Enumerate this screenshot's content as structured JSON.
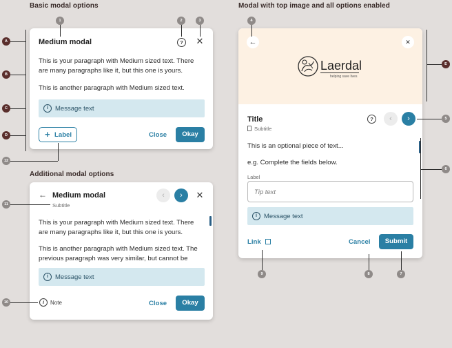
{
  "sections": {
    "basic": "Basic modal options",
    "additional": "Additional modal options",
    "top_image": "Modal with top image and all options enabled"
  },
  "basic_modal": {
    "title": "Medium modal",
    "para1": "This is your paragraph with Medium sized text. There are many paragraphs like it, but this one is yours.",
    "para2": "This is another paragraph with Medium sized text.",
    "message": "Message text",
    "label_button": "Label",
    "label_button_icon": "plus-icon",
    "close_button": "Close",
    "okay_button": "Okay"
  },
  "additional_modal": {
    "title": "Medium modal",
    "subtitle": "Subtitle",
    "para1": "This is your paragraph with Medium sized text. There are many paragraphs like it, but this one is yours.",
    "para2": "This is another paragraph with Medium sized text. The previous paragraph was very similar, but cannot be",
    "message": "Message text",
    "note": "Note",
    "close_button": "Close",
    "okay_button": "Okay"
  },
  "image_modal": {
    "logo_text": "Laerdal",
    "logo_tagline": "helping save lives",
    "title": "Title",
    "subtitle": "Subtitle",
    "text1": "This is an optional piece of text...",
    "text2": "e.g. Complete the fields below.",
    "field_label": "Label",
    "field_placeholder": "Tip text",
    "message": "Message text",
    "link": "Link",
    "cancel_button": "Cancel",
    "submit_button": "Submit"
  },
  "markers": {
    "m1": "1",
    "m2": "2",
    "m3": "3",
    "m4": "4",
    "m5": "5",
    "m6": "6",
    "m7": "7",
    "m8": "8",
    "m9": "9",
    "m10": "10",
    "m11": "11",
    "m12": "12",
    "mA": "A",
    "mB": "B",
    "mC": "C",
    "mD": "D",
    "mE": "E"
  },
  "colors": {
    "background": "#e2dedc",
    "primary": "#2a7fa4",
    "info_bg": "#d4e8ef",
    "image_bg": "#fdf1e3",
    "marker_grey": "#8f8a88",
    "marker_dark": "#5a2e2c"
  }
}
